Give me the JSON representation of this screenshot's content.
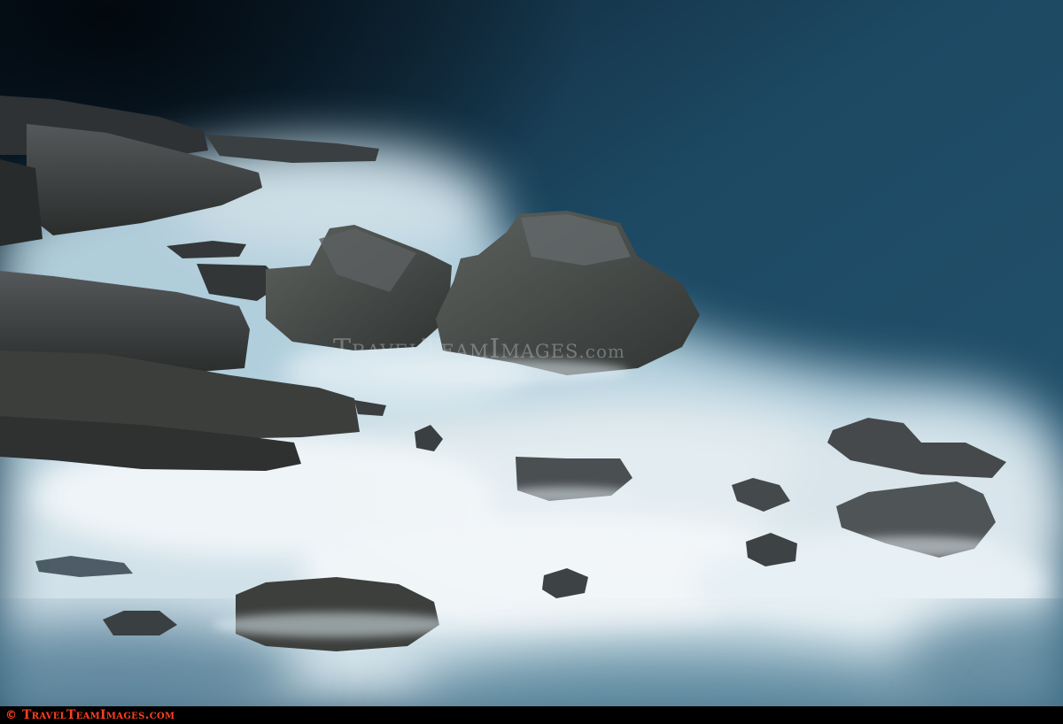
{
  "photo": {
    "subject": "long-exposure sea mist around rocks",
    "colors": {
      "sea": "#1f4a66",
      "sea_dark": "#0b1e2c",
      "foam": "#e8f1f6",
      "rock": "#3c3f3b"
    }
  },
  "watermark": {
    "brand": "TravelTeamImages",
    "domain": ".com"
  },
  "footer": {
    "copyright_symbol": "©",
    "site": "TravelTeamImages.com"
  }
}
